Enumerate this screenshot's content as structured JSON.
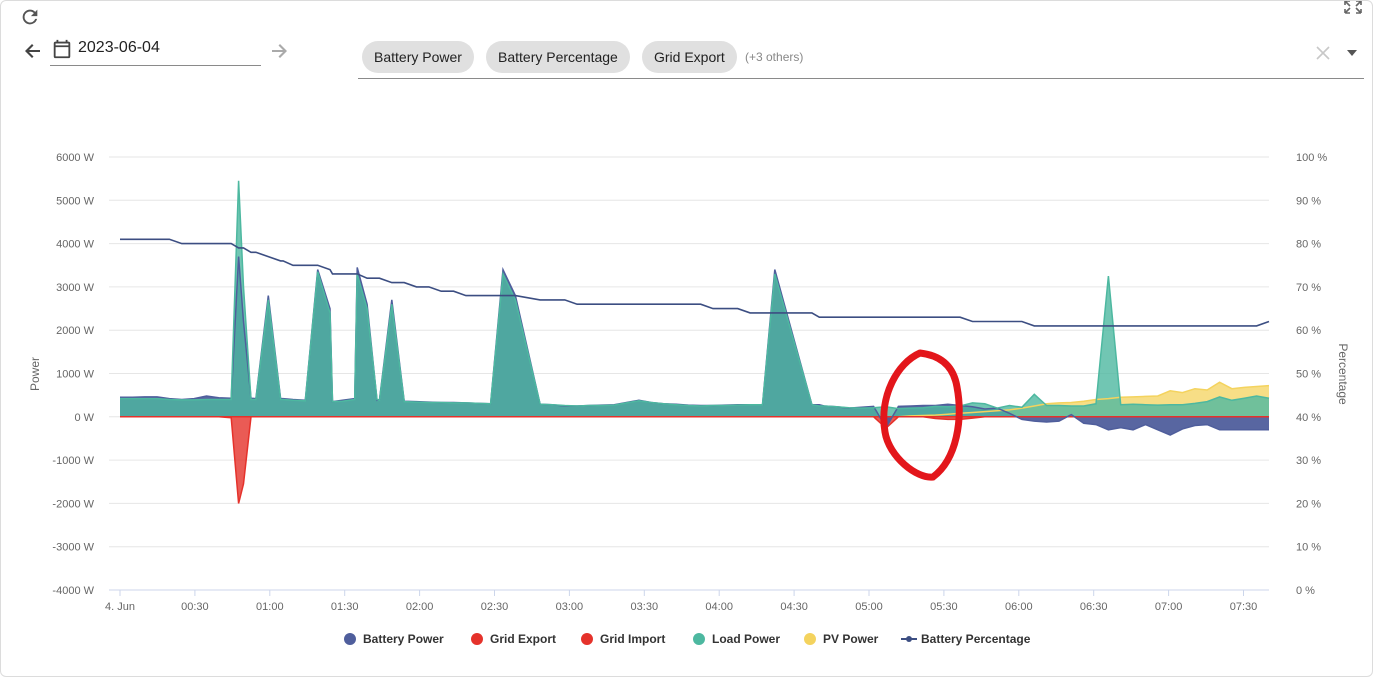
{
  "toolbar": {
    "date_value": "2023-06-04",
    "chips": [
      "Battery Power",
      "Battery Percentage",
      "Grid Export"
    ],
    "more_chips": "(+3 others)"
  },
  "icons": {
    "refresh": "refresh-icon",
    "expand": "expand-icon",
    "prev": "arrow-left-icon",
    "next": "arrow-right-icon",
    "calendar": "calendar-icon",
    "clear": "close-icon",
    "dropdown": "chevron-down-icon"
  },
  "chart_data": {
    "type": "area",
    "ylabel": "Power",
    "y2label": "Percentage",
    "ylim": [
      -4000,
      6000
    ],
    "y2lim": [
      0,
      100
    ],
    "y_ticks": [
      "6000 W",
      "5000 W",
      "4000 W",
      "3000 W",
      "2000 W",
      "1000 W",
      "0 W",
      "-1000 W",
      "-2000 W",
      "-3000 W",
      "-4000 W"
    ],
    "y2_ticks": [
      "100 %",
      "90 %",
      "80 %",
      "70 %",
      "60 %",
      "50 %",
      "40 %",
      "30 %",
      "20 %",
      "10 %",
      "0 %"
    ],
    "x_ticks": [
      "4. Jun",
      "00:30",
      "01:00",
      "01:30",
      "02:00",
      "02:30",
      "03:00",
      "03:30",
      "04:00",
      "04:30",
      "05:00",
      "05:30",
      "06:00",
      "06:30",
      "07:00",
      "07:30"
    ],
    "x_range_minutes": [
      0,
      465
    ],
    "x_minutes": [
      0,
      5,
      10,
      15,
      20,
      25,
      30,
      35,
      40,
      45,
      48,
      50,
      53,
      55,
      60,
      65,
      66,
      70,
      75,
      80,
      85,
      86,
      90,
      95,
      96,
      100,
      104,
      105,
      110,
      115,
      120,
      125,
      130,
      135,
      140,
      145,
      150,
      155,
      160,
      170,
      175,
      180,
      185,
      190,
      195,
      200,
      205,
      210,
      215,
      220,
      225,
      230,
      235,
      240,
      245,
      250,
      255,
      260,
      265,
      280,
      283,
      285,
      290,
      295,
      300,
      305,
      310,
      315,
      320,
      325,
      330,
      335,
      340,
      345,
      350,
      355,
      360,
      365,
      370,
      375,
      380,
      385,
      390,
      395,
      400,
      405,
      410,
      415,
      420,
      425,
      430,
      435,
      440,
      445,
      450,
      455,
      460,
      465
    ],
    "series": [
      {
        "name": "Battery Power",
        "color": "#4f5e9c",
        "values": [
          450,
          450,
          460,
          460,
          420,
          400,
          420,
          480,
          440,
          430,
          3700,
          2200,
          430,
          420,
          2800,
          420,
          420,
          400,
          380,
          3400,
          2500,
          350,
          380,
          420,
          3450,
          2600,
          380,
          400,
          2700,
          360,
          350,
          340,
          330,
          330,
          320,
          310,
          300,
          3400,
          2800,
          290,
          280,
          250,
          250,
          260,
          270,
          280,
          330,
          380,
          330,
          300,
          290,
          270,
          260,
          260,
          270,
          280,
          280,
          280,
          3400,
          280,
          280,
          250,
          230,
          200,
          220,
          240,
          -250,
          240,
          250,
          260,
          260,
          290,
          260,
          230,
          180,
          200,
          80,
          -60,
          -100,
          -120,
          -100,
          50,
          -150,
          -180,
          -300,
          -250,
          -300,
          -180,
          -300,
          -420,
          -280,
          -200,
          -180,
          -300,
          -300,
          -300,
          -300,
          -300
        ]
      },
      {
        "name": "Grid Export",
        "color": "#e5322b",
        "values": [
          0,
          0,
          0,
          0,
          0,
          0,
          0,
          0,
          0,
          -20,
          -2000,
          -1550,
          0,
          0,
          0,
          0,
          0,
          0,
          0,
          0,
          0,
          0,
          0,
          0,
          0,
          0,
          0,
          0,
          0,
          0,
          0,
          0,
          0,
          0,
          0,
          0,
          0,
          0,
          0,
          0,
          0,
          0,
          0,
          0,
          0,
          0,
          0,
          0,
          0,
          0,
          0,
          0,
          0,
          0,
          0,
          0,
          0,
          0,
          0,
          0,
          0,
          0,
          0,
          0,
          0,
          0,
          -260,
          0,
          0,
          0,
          -40,
          -60,
          -60,
          -30,
          0,
          0,
          0,
          0,
          0,
          0,
          0,
          0,
          0,
          0,
          0,
          0,
          0,
          0,
          0,
          0,
          0,
          0,
          0,
          0,
          0,
          0,
          0,
          0
        ]
      },
      {
        "name": "Grid Import",
        "color": "#e5322b",
        "values": [
          0,
          0,
          0,
          0,
          0,
          0,
          0,
          0,
          0,
          0,
          0,
          0,
          0,
          0,
          0,
          0,
          0,
          0,
          0,
          0,
          0,
          0,
          0,
          0,
          0,
          0,
          0,
          0,
          0,
          0,
          0,
          0,
          0,
          0,
          0,
          0,
          0,
          0,
          0,
          0,
          0,
          0,
          0,
          0,
          0,
          0,
          0,
          0,
          0,
          0,
          0,
          0,
          0,
          0,
          0,
          0,
          0,
          0,
          0,
          0,
          0,
          0,
          0,
          0,
          0,
          0,
          0,
          0,
          0,
          0,
          0,
          0,
          0,
          0,
          0,
          0,
          0,
          0,
          0,
          0,
          0,
          0,
          0,
          0,
          0,
          0,
          0,
          0,
          0,
          0,
          0,
          0,
          0,
          0,
          0,
          0,
          0,
          0
        ]
      },
      {
        "name": "Load Power",
        "color": "#4db8a0",
        "values": [
          420,
          420,
          420,
          420,
          400,
          390,
          390,
          400,
          400,
          400,
          5450,
          3000,
          400,
          400,
          2700,
          400,
          400,
          380,
          370,
          3350,
          2400,
          350,
          360,
          400,
          3300,
          2500,
          400,
          380,
          2600,
          350,
          340,
          330,
          330,
          320,
          320,
          310,
          300,
          3300,
          2700,
          290,
          280,
          260,
          250,
          260,
          260,
          270,
          320,
          370,
          330,
          300,
          280,
          260,
          250,
          260,
          260,
          270,
          280,
          280,
          3300,
          280,
          250,
          250,
          230,
          210,
          200,
          210,
          230,
          190,
          200,
          210,
          240,
          230,
          250,
          320,
          300,
          200,
          260,
          220,
          520,
          260,
          260,
          250,
          250,
          300,
          3250,
          280,
          290,
          280,
          270,
          280,
          280,
          310,
          350,
          460,
          380,
          430,
          480,
          430,
          380
        ]
      },
      {
        "name": "PV Power",
        "color": "#f4d35e",
        "values": [
          0,
          0,
          0,
          0,
          0,
          0,
          0,
          0,
          0,
          0,
          0,
          0,
          0,
          0,
          0,
          0,
          0,
          0,
          0,
          0,
          0,
          0,
          0,
          0,
          0,
          0,
          0,
          0,
          0,
          0,
          0,
          0,
          0,
          0,
          0,
          0,
          0,
          0,
          0,
          0,
          0,
          0,
          0,
          0,
          0,
          0,
          0,
          0,
          0,
          0,
          0,
          0,
          0,
          0,
          0,
          0,
          0,
          0,
          0,
          0,
          0,
          0,
          0,
          0,
          0,
          0,
          0,
          0,
          20,
          30,
          40,
          60,
          80,
          100,
          120,
          140,
          160,
          200,
          250,
          300,
          320,
          330,
          360,
          400,
          420,
          450,
          460,
          470,
          480,
          600,
          560,
          650,
          620,
          800,
          650,
          680,
          700,
          720
        ]
      },
      {
        "name": "Battery Percentage",
        "color": "#3c4e82",
        "axis": "right",
        "values": [
          81,
          81,
          81,
          81,
          81,
          80,
          80,
          80,
          80,
          80,
          79,
          79,
          78,
          78,
          77,
          76,
          76,
          75,
          75,
          75,
          74,
          73,
          73,
          73,
          73,
          72,
          72,
          72,
          71,
          71,
          70,
          70,
          69,
          69,
          68,
          68,
          68,
          68,
          68,
          67,
          67,
          67,
          66,
          66,
          66,
          66,
          66,
          66,
          66,
          66,
          66,
          66,
          66,
          65,
          65,
          65,
          64,
          64,
          64,
          64,
          63,
          63,
          63,
          63,
          63,
          63,
          63,
          63,
          63,
          63,
          63,
          63,
          63,
          62,
          62,
          62,
          62,
          62,
          61,
          61,
          61,
          61,
          61,
          61,
          61,
          61,
          61,
          61,
          61,
          61,
          61,
          61,
          61,
          61,
          61,
          61,
          61,
          62,
          62
        ]
      }
    ],
    "legend": {
      "placement": "bottom-center",
      "items": [
        "Battery Power",
        "Grid Export",
        "Grid Import",
        "Load Power",
        "PV Power",
        "Battery Percentage"
      ]
    },
    "grid": true
  }
}
